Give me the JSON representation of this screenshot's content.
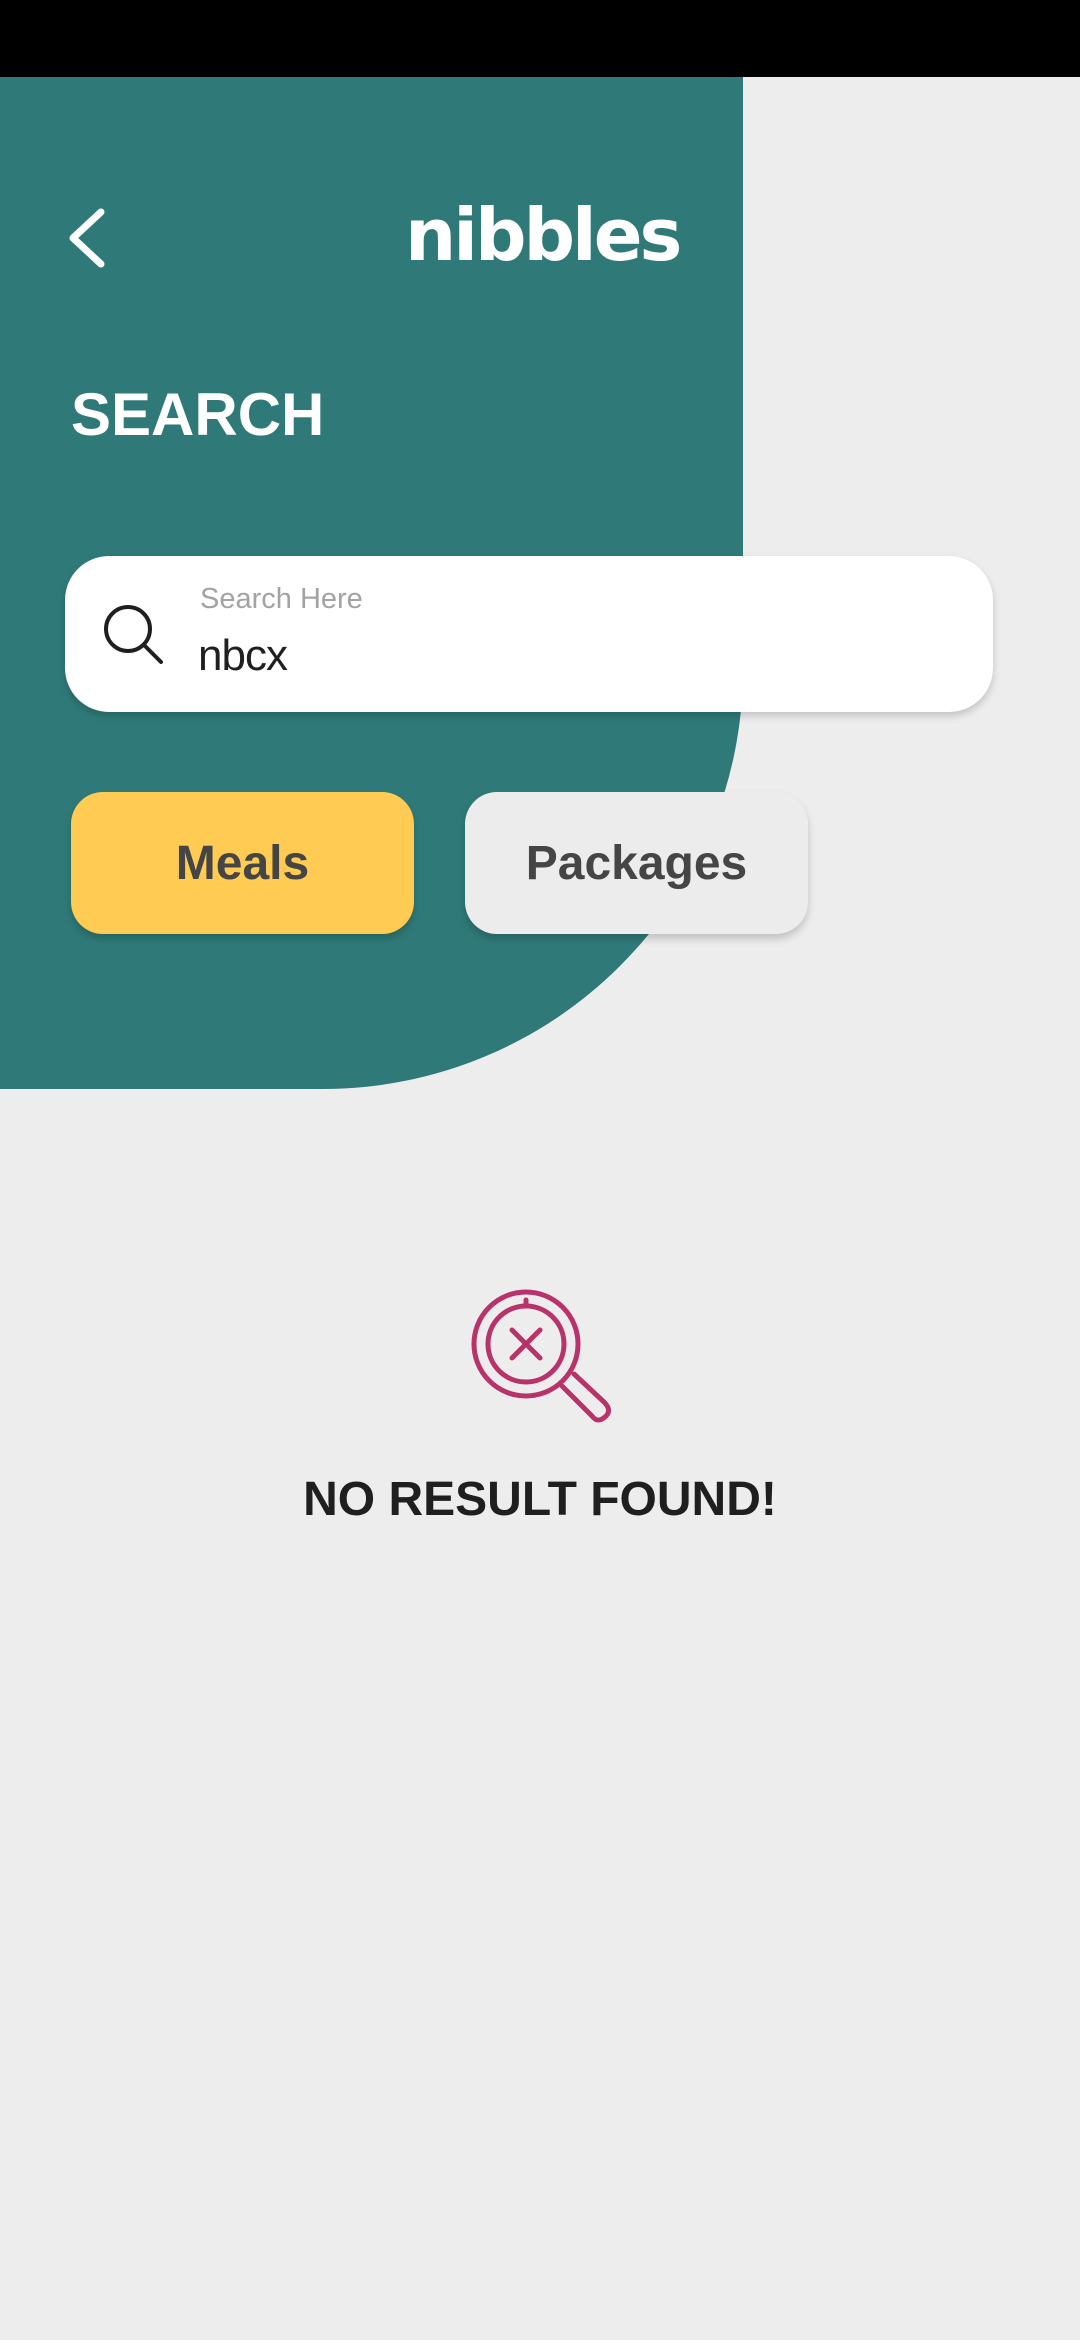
{
  "header": {
    "back_icon": "chevron-left-icon",
    "logo_text": "nibbles"
  },
  "page": {
    "title": "SEARCH"
  },
  "search": {
    "icon": "search-icon",
    "placeholder": "Search Here",
    "value": "nbcx"
  },
  "tabs": [
    {
      "label": "Meals",
      "selected": true
    },
    {
      "label": "Packages",
      "selected": false
    }
  ],
  "empty_state": {
    "icon": "no-result-search-icon",
    "message": "NO RESULT FOUND!"
  },
  "colors": {
    "teal": "#2f7a78",
    "background": "#ededed",
    "tab_selected": "#ffcb52",
    "tab_unselected": "#ececec",
    "empty_icon": "#b8336a"
  }
}
